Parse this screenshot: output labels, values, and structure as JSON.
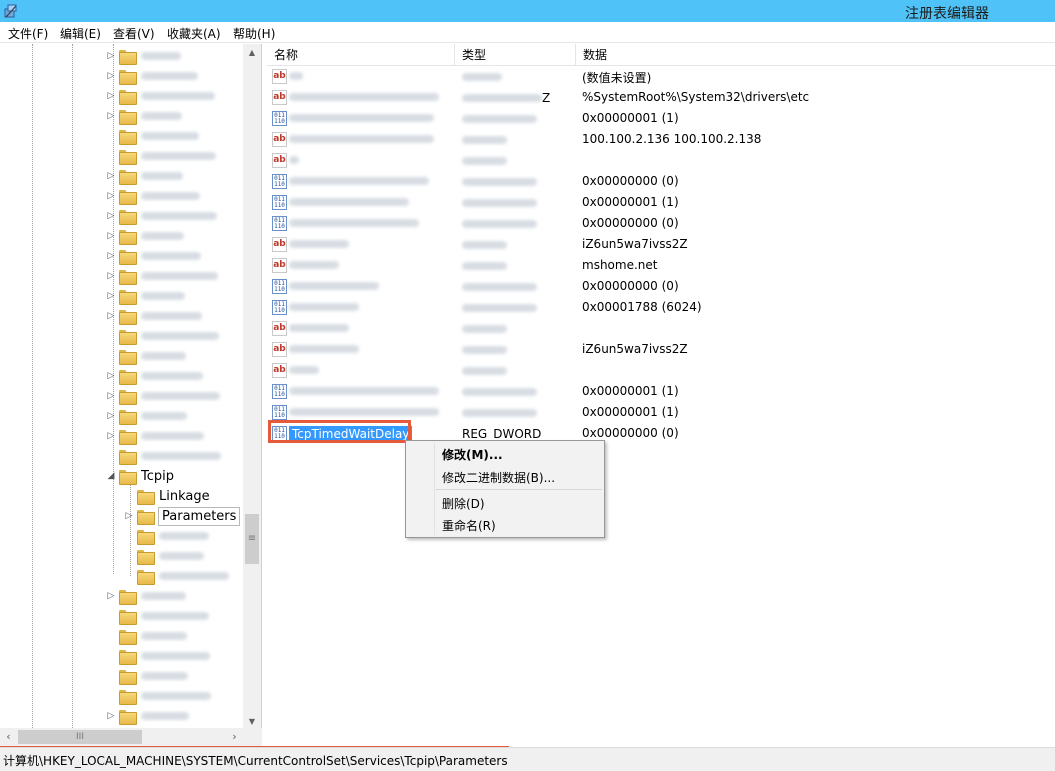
{
  "window": {
    "title": "注册表编辑器",
    "icon": "regedit-icon"
  },
  "menu": [
    "文件(F)",
    "编辑(E)",
    "查看(V)",
    "收藏夹(A)",
    "帮助(H)"
  ],
  "tree": {
    "tcpip_label": "Tcpip",
    "linkage_label": "Linkage",
    "parameters_label": "Parameters"
  },
  "columns": {
    "name": "名称",
    "type": "类型",
    "data": "数据"
  },
  "values": [
    {
      "icon": "ab",
      "name": "",
      "type": "",
      "data": "(数值未设置)"
    },
    {
      "icon": "ab",
      "name": "",
      "type": "",
      "data": "%SystemRoot%\\System32\\drivers\\etc",
      "type_suffix": "Z"
    },
    {
      "icon": "bin",
      "name": "",
      "type": "",
      "data": "0x00000001 (1)"
    },
    {
      "icon": "ab",
      "name": "",
      "type": "",
      "data": "100.100.2.136 100.100.2.138"
    },
    {
      "icon": "ab",
      "name": "",
      "type": "",
      "data": ""
    },
    {
      "icon": "bin",
      "name": "",
      "type": "",
      "data": "0x00000000 (0)"
    },
    {
      "icon": "bin",
      "name": "",
      "type": "",
      "data": "0x00000001 (1)"
    },
    {
      "icon": "bin",
      "name": "",
      "type": "",
      "data": "0x00000000 (0)"
    },
    {
      "icon": "ab",
      "name": "",
      "type": "",
      "data": "iZ6un5wa7ivss2Z"
    },
    {
      "icon": "ab",
      "name": "",
      "type": "",
      "data": "mshome.net"
    },
    {
      "icon": "bin",
      "name": "",
      "type": "",
      "data": "0x00000000 (0)"
    },
    {
      "icon": "bin",
      "name": "",
      "type": "",
      "data": "0x00001788 (6024)"
    },
    {
      "icon": "ab",
      "name": "",
      "type": "",
      "data": ""
    },
    {
      "icon": "ab",
      "name": "",
      "type": "",
      "data": "iZ6un5wa7ivss2Z"
    },
    {
      "icon": "ab",
      "name": "",
      "type": "",
      "data": ""
    },
    {
      "icon": "bin",
      "name": "",
      "type": "",
      "data": "0x00000001 (1)"
    },
    {
      "icon": "bin",
      "name": "",
      "type": "",
      "data": "0x00000001 (1)"
    },
    {
      "icon": "bin",
      "name": "TcpTimedWaitDelay",
      "type": "REG_DWORD",
      "data": "0x00000000 (0)",
      "selected": true
    }
  ],
  "context_menu": {
    "modify": "修改(M)...",
    "modify_binary": "修改二进制数据(B)...",
    "delete": "删除(D)",
    "rename": "重命名(R)"
  },
  "status": {
    "path": "计算机\\HKEY_LOCAL_MACHINE\\SYSTEM\\CurrentControlSet\\Services\\Tcpip\\Parameters"
  },
  "colors": {
    "titlebar": "#4fc3f7",
    "selection": "#3399ff",
    "highlight_box": "#e55a3b"
  }
}
